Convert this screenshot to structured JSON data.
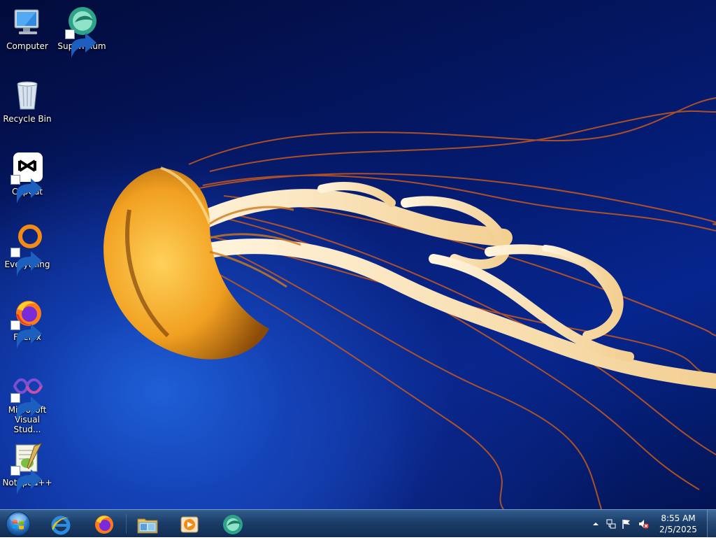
{
  "desktop": {
    "icons": [
      {
        "label": "Computer",
        "icon": "computer-icon"
      },
      {
        "label": "Supermium",
        "icon": "supermium-icon"
      },
      {
        "label": "Recycle Bin",
        "icon": "recycle-bin-icon"
      },
      {
        "label": "CapCut",
        "icon": "capcut-icon"
      },
      {
        "label": "Everything",
        "icon": "everything-icon"
      },
      {
        "label": "Firefox",
        "icon": "firefox-icon"
      },
      {
        "label": "Microsoft Visual Stud...",
        "icon": "visual-studio-icon"
      },
      {
        "label": "Notepad++",
        "icon": "notepad-plus-plus-icon"
      }
    ]
  },
  "taskbar": {
    "pinned": [
      {
        "name": "internet-explorer",
        "icon": "internet-explorer-icon"
      },
      {
        "name": "firefox",
        "icon": "firefox-icon"
      },
      {
        "name": "file-explorer",
        "icon": "folder-icon"
      },
      {
        "name": "media-player",
        "icon": "media-player-icon"
      },
      {
        "name": "supermium",
        "icon": "supermium-icon"
      }
    ],
    "tray": {
      "time": "8:55 AM",
      "date": "2/5/2025",
      "icons": [
        "show-hidden-icons-icon",
        "network-icon",
        "action-center-flag-icon",
        "volume-muted-icon"
      ]
    }
  }
}
